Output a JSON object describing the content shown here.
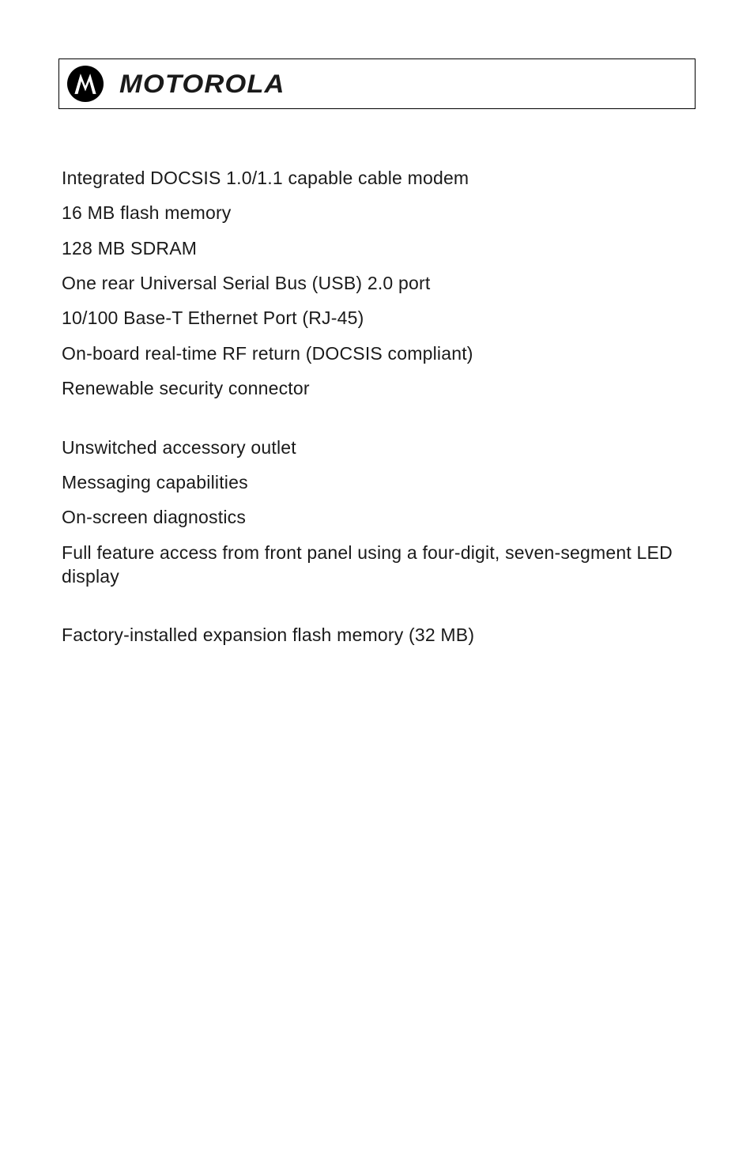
{
  "header": {
    "brand": "MOTOROLA"
  },
  "sections": [
    {
      "items": [
        "Integrated DOCSIS 1.0/1.1 capable cable modem",
        "16 MB flash memory",
        "128 MB SDRAM",
        "One rear Universal Serial Bus (USB) 2.0 port",
        "10/100 Base-T Ethernet Port (RJ-45)",
        "On-board real-time RF return (DOCSIS compliant)",
        "Renewable security connector"
      ]
    },
    {
      "items": [
        "Unswitched accessory outlet",
        "Messaging capabilities",
        "On-screen diagnostics",
        "Full feature access from front panel using a four-digit, seven-segment LED display"
      ]
    },
    {
      "items": [
        "Factory-installed expansion flash memory (32 MB)"
      ]
    }
  ]
}
